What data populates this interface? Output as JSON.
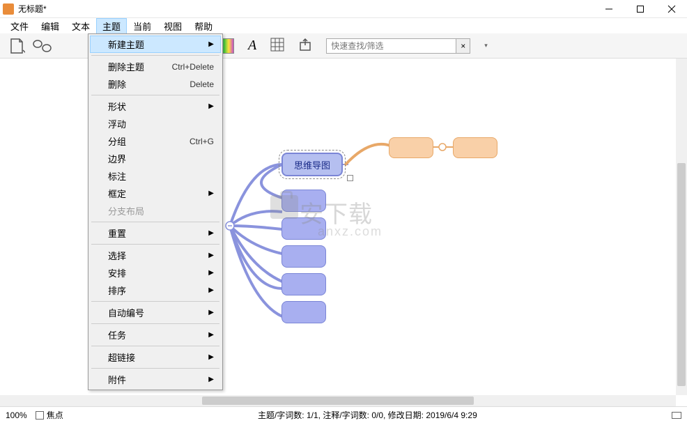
{
  "title": "无标题*",
  "menubar": {
    "file": "文件",
    "edit": "编辑",
    "text": "文本",
    "topic": "主题",
    "current": "当前",
    "view": "视图",
    "help": "帮助"
  },
  "dropdown": {
    "new_topic": "新建主题",
    "delete_topic": "删除主题",
    "delete_topic_sc": "Ctrl+Delete",
    "delete": "删除",
    "delete_sc": "Delete",
    "shape": "形状",
    "float": "浮动",
    "group": "分组",
    "group_sc": "Ctrl+G",
    "border": "边界",
    "callout": "标注",
    "frame": "框定",
    "branch_layout": "分支布局",
    "reset": "重置",
    "select": "选择",
    "arrange": "安排",
    "sort": "排序",
    "auto_number": "自动编号",
    "task": "任务",
    "hyperlink": "超链接",
    "attachment": "附件"
  },
  "search": {
    "placeholder": "快速查找/筛选"
  },
  "main_node": "思维导图",
  "watermark": {
    "text": "安下载",
    "sub": "anxz.com"
  },
  "status": {
    "zoom": "100%",
    "focus": "焦点",
    "center": "主题/字词数: 1/1, 注释/字词数: 0/0, 修改日期: 2019/6/4 9:29"
  }
}
